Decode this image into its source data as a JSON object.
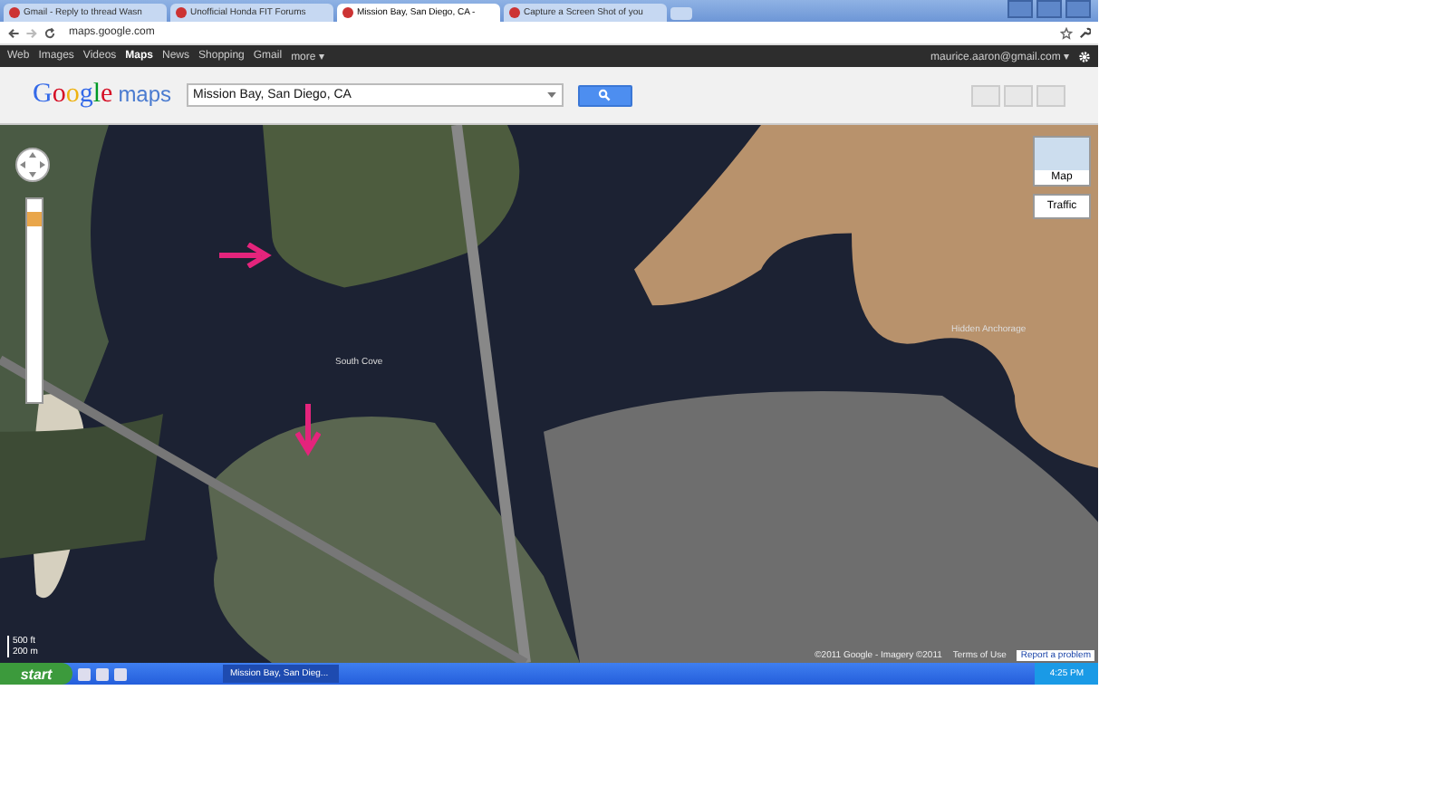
{
  "browser": {
    "tabs": [
      {
        "label": "Gmail - Reply to thread Wasn",
        "selected": false
      },
      {
        "label": "Unofficial Honda FIT Forums",
        "selected": false
      },
      {
        "label": "Mission Bay, San Diego, CA -",
        "selected": true
      },
      {
        "label": "Capture a Screen Shot of you",
        "selected": false
      }
    ],
    "address": "maps.google.com"
  },
  "google_bar": {
    "links": [
      {
        "label": "Web",
        "selected": false
      },
      {
        "label": "Images",
        "selected": false
      },
      {
        "label": "Videos",
        "selected": false
      },
      {
        "label": "Maps",
        "selected": true
      },
      {
        "label": "News",
        "selected": false
      },
      {
        "label": "Shopping",
        "selected": false
      },
      {
        "label": "Gmail",
        "selected": false
      },
      {
        "label": "more ▾",
        "selected": false
      }
    ],
    "account": "maurice.aaron@gmail.com ▾"
  },
  "header": {
    "logo_word": "Google",
    "logo_product": "maps",
    "search": {
      "value": "Mission Bay, San Diego, CA"
    }
  },
  "map": {
    "zoom": {
      "level": 0.93
    },
    "labels": [
      "South Cove",
      "Hidden Anchorage"
    ],
    "type_buttons": [
      "Map",
      "Traffic"
    ],
    "scale": [
      "500 ft",
      "200 m"
    ],
    "copyright": "©2011 Google - Imagery ©2011",
    "terms": "Terms of Use",
    "report_link": "Report a problem"
  },
  "taskbar": {
    "start": "start",
    "windows": [
      {
        "label": "Mission Bay, San Dieg...",
        "selected": true
      }
    ],
    "clock": "4:25 PM"
  }
}
